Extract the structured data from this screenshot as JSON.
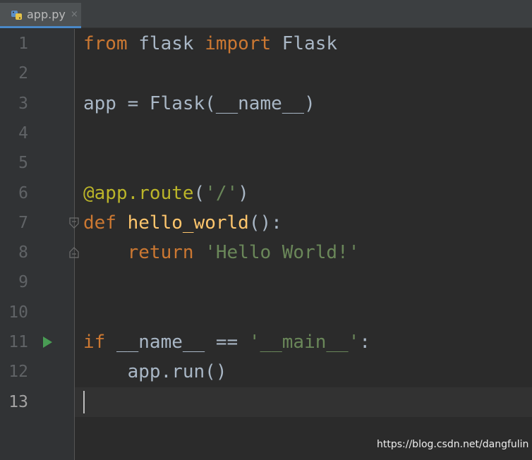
{
  "tab": {
    "label": "app.py",
    "close_glyph": "×",
    "icon": "python-file-icon"
  },
  "editor": {
    "current_line": 13,
    "line_numbers": [
      "1",
      "2",
      "3",
      "4",
      "5",
      "6",
      "7",
      "8",
      "9",
      "10",
      "11",
      "12",
      "13"
    ],
    "lines": [
      [
        {
          "t": "from",
          "c": "kw"
        },
        {
          "t": " flask ",
          "c": "plain"
        },
        {
          "t": "import",
          "c": "kw"
        },
        {
          "t": " Flask",
          "c": "plain"
        }
      ],
      [],
      [
        {
          "t": "app = Flask(__name__)",
          "c": "plain"
        }
      ],
      [],
      [],
      [
        {
          "t": "@app.route",
          "c": "dec"
        },
        {
          "t": "(",
          "c": "plain"
        },
        {
          "t": "'/'",
          "c": "str"
        },
        {
          "t": ")",
          "c": "plain"
        }
      ],
      [
        {
          "t": "def",
          "c": "kw"
        },
        {
          "t": " ",
          "c": "plain"
        },
        {
          "t": "hello_world",
          "c": "fn"
        },
        {
          "t": "():",
          "c": "plain"
        }
      ],
      [
        {
          "t": "    ",
          "c": "plain"
        },
        {
          "t": "return",
          "c": "kw"
        },
        {
          "t": " ",
          "c": "plain"
        },
        {
          "t": "'Hello World!'",
          "c": "str"
        }
      ],
      [],
      [],
      [
        {
          "t": "if",
          "c": "kw"
        },
        {
          "t": " __name__ == ",
          "c": "plain"
        },
        {
          "t": "'__main__'",
          "c": "str"
        },
        {
          "t": ":",
          "c": "plain"
        }
      ],
      [
        {
          "t": "    app.run()",
          "c": "plain"
        }
      ],
      []
    ],
    "fold_markers_on_lines": [
      7,
      8
    ],
    "run_marker_on_line": 11
  },
  "colors": {
    "background": "#2b2b2b",
    "gutter": "#313335",
    "keyword": "#cc7832",
    "string": "#6a8759",
    "decorator": "#bbb529",
    "function": "#ffc66d",
    "default": "#a9b7c6",
    "run_icon": "#499c54",
    "tab_underline": "#4a88c7"
  },
  "watermark": "https://blog.csdn.net/dangfulin"
}
